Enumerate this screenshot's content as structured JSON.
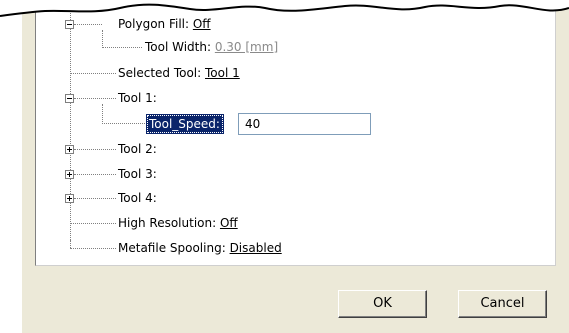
{
  "tree": {
    "polygon_fill": {
      "label": "Polygon Fill: ",
      "value": "Off"
    },
    "tool_width": {
      "label": "Tool Width: ",
      "value": "0.30 [mm]"
    },
    "selected_tool": {
      "label": "Selected Tool: ",
      "value": "Tool 1"
    },
    "tool1": {
      "label": "Tool 1:"
    },
    "tool_speed": {
      "label": "Tool_Speed:",
      "value": "40"
    },
    "tool2": {
      "label": "Tool 2:"
    },
    "tool3": {
      "label": "Tool 3:"
    },
    "tool4": {
      "label": "Tool 4:"
    },
    "high_resolution": {
      "label": "High Resolution: ",
      "value": "Off"
    },
    "metafile_spooling": {
      "label": "Metafile Spooling: ",
      "value": "Disabled"
    }
  },
  "buttons": {
    "ok": "OK",
    "cancel": "Cancel"
  },
  "colors": {
    "dialog_background": "#ece9d8",
    "selection": "#0a246a",
    "input_border": "#7f9db9"
  }
}
